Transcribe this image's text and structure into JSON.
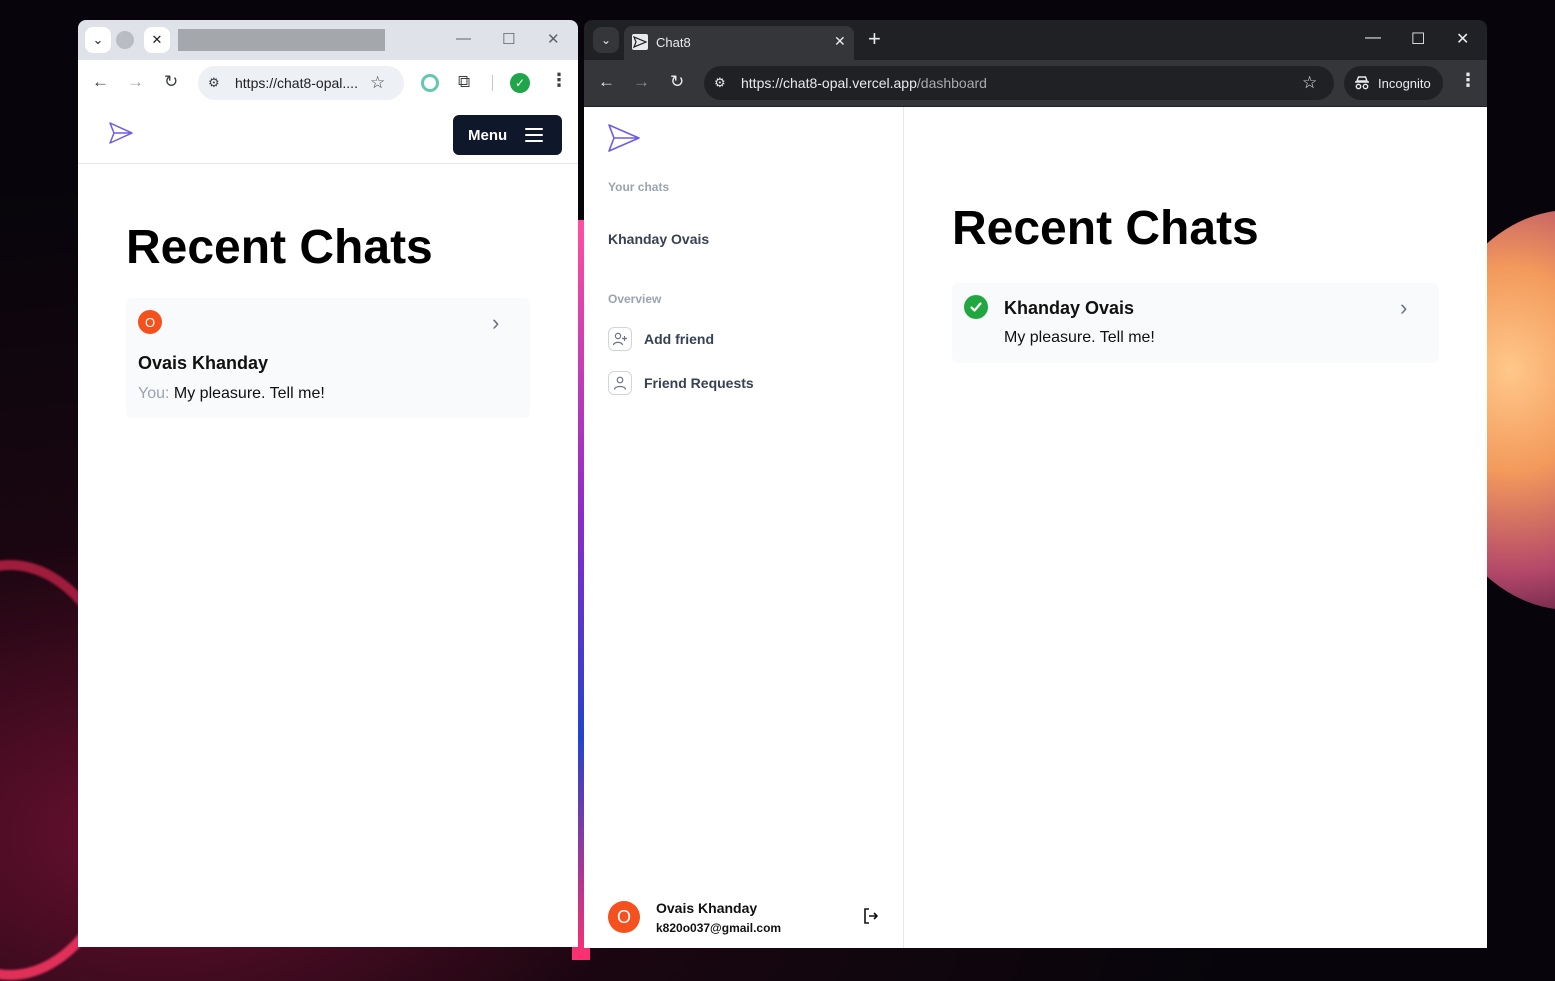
{
  "colors": {
    "brand_logo": "#6d5ce7",
    "avatar_bg": "#f4511e",
    "online_green": "#22a63f",
    "menu_button_bg": "#0f172a",
    "incognito_chrome": "#202124"
  },
  "left_window": {
    "tab_close_glyph": "✕",
    "url_display": "https://chat8-opal....",
    "page": {
      "menu_label": "Menu",
      "title": "Recent Chats",
      "chat": {
        "avatar_initial": "O",
        "name": "Ovais Khanday",
        "prefix": "You:",
        "message": "My pleasure. Tell me!"
      }
    }
  },
  "right_window": {
    "tab_title": "Chat8",
    "url_host": "https://chat8-opal.vercel.app",
    "url_path": "/dashboard",
    "incognito_label": "Incognito",
    "sidebar": {
      "your_chats_label": "Your chats",
      "chats": [
        "Khanday Ovais"
      ],
      "overview_label": "Overview",
      "nav": [
        {
          "label": "Add friend",
          "icon": "user-plus-icon"
        },
        {
          "label": "Friend Requests",
          "icon": "user-icon"
        }
      ],
      "user": {
        "avatar_initial": "O",
        "name": "Ovais Khanday",
        "email": "k820o037@gmail.com"
      }
    },
    "main": {
      "title": "Recent Chats",
      "chat": {
        "name": "Khanday Ovais",
        "message": "My pleasure. Tell me!",
        "status_icon": "check-circle-icon"
      }
    }
  }
}
